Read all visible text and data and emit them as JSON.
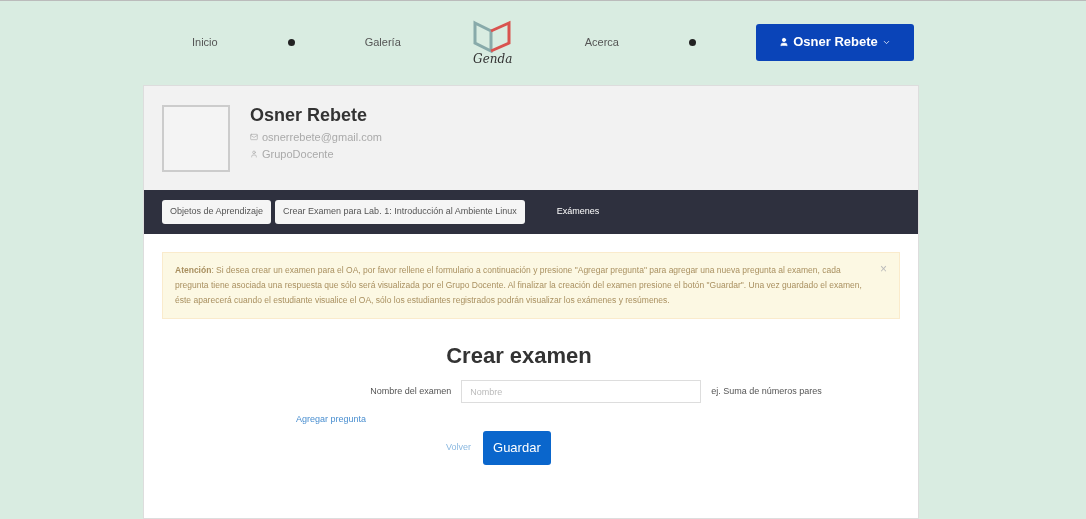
{
  "nav": {
    "items": [
      {
        "kind": "link",
        "label": "Inicio"
      },
      {
        "kind": "dot"
      },
      {
        "kind": "link",
        "label": "Galería"
      },
      {
        "kind": "logo",
        "label": "Genda"
      },
      {
        "kind": "link",
        "label": "Acerca"
      },
      {
        "kind": "dot"
      }
    ],
    "user_button": {
      "label": "Osner Rebete"
    }
  },
  "profile": {
    "name": "Osner Rebete",
    "email": "osnerrebete@gmail.com",
    "group": "GrupoDocente"
  },
  "breadcrumb": {
    "items": [
      "Objetos de Aprendizaje",
      "Crear Examen para Lab. 1: Introducción al Ambiente Linux"
    ],
    "link": "Exámenes"
  },
  "alert": {
    "text": "**Atención**: Si desea crear un examen para el OA, por favor rellene el formulario a continuación y presione \"Agregar pregunta\" para agregar una nueva pregunta al examen, cada pregunta tiene asociada una respuesta que sólo será visualizada por el Grupo Docente. Al finalizar la creación del examen presione el botón \"Guardar\". Una vez guardado el examen, éste aparecerá cuando el estudiante visualice el OA, sólo los estudiantes registrados podrán visualizar los exámenes y resúmenes.",
    "close": "×"
  },
  "form": {
    "title": "Crear examen",
    "label": "Nombre del examen",
    "placeholder": "Nombre",
    "hint": "ej. Suma de números pares",
    "add_link": "Agregar pregunta",
    "back_link": "Volver",
    "save_button": "Guardar"
  }
}
